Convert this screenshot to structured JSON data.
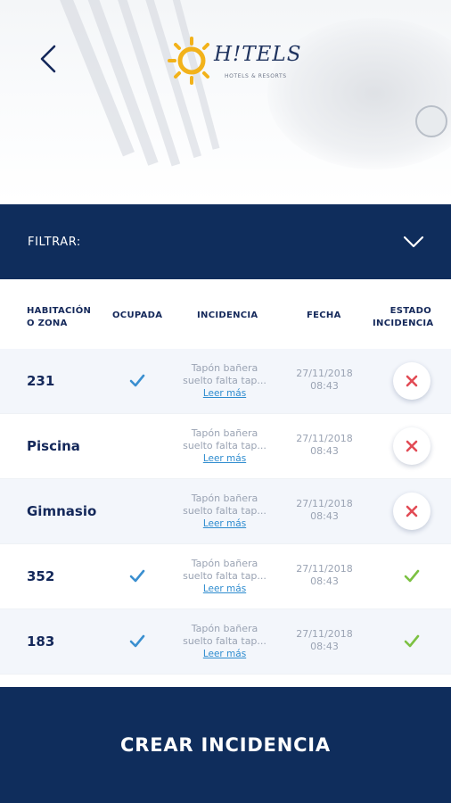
{
  "header": {
    "logo_text": "H!TELS",
    "logo_sub": "HOTELS & RESORTS",
    "back_icon": "chevron-left-icon"
  },
  "filter": {
    "label": "FILTRAR:",
    "icon": "chevron-down-icon"
  },
  "table": {
    "columns": {
      "room_line1": "HABITACIÓN",
      "room_line2": "O ZONA",
      "occupied": "OCUPADA",
      "incident": "INCIDENCIA",
      "date": "FECHA",
      "status_line1": "ESTADO",
      "status_line2": "INCIDENCIA"
    },
    "rows": [
      {
        "room": "231",
        "occupied": true,
        "incident_line1": "Tapón bañera",
        "incident_line2": "suelto falta tap...",
        "read_more": "Leer más",
        "date": "27/11/2018",
        "time": "08:43",
        "status": "open"
      },
      {
        "room": "Piscina",
        "occupied": false,
        "incident_line1": "Tapón bañera",
        "incident_line2": "suelto falta tap...",
        "read_more": "Leer más",
        "date": "27/11/2018",
        "time": "08:43",
        "status": "open"
      },
      {
        "room": "Gimnasio",
        "occupied": false,
        "incident_line1": "Tapón bañera",
        "incident_line2": "suelto falta tap...",
        "read_more": "Leer más",
        "date": "27/11/2018",
        "time": "08:43",
        "status": "open"
      },
      {
        "room": "352",
        "occupied": true,
        "incident_line1": "Tapón bañera",
        "incident_line2": "suelto falta tap...",
        "read_more": "Leer más",
        "date": "27/11/2018",
        "time": "08:43",
        "status": "resolved"
      },
      {
        "room": "183",
        "occupied": true,
        "incident_line1": "Tapón bañera",
        "incident_line2": "suelto falta tap...",
        "read_more": "Leer más",
        "date": "27/11/2018",
        "time": "08:43",
        "status": "resolved"
      }
    ]
  },
  "cta": {
    "label": "CREAR INCIDENCIA"
  },
  "colors": {
    "navy": "#0f2d5c",
    "check_blue": "#3a8fd0",
    "check_green": "#7cc142",
    "error_red": "#e24b55",
    "link_blue": "#2e8ccf"
  }
}
